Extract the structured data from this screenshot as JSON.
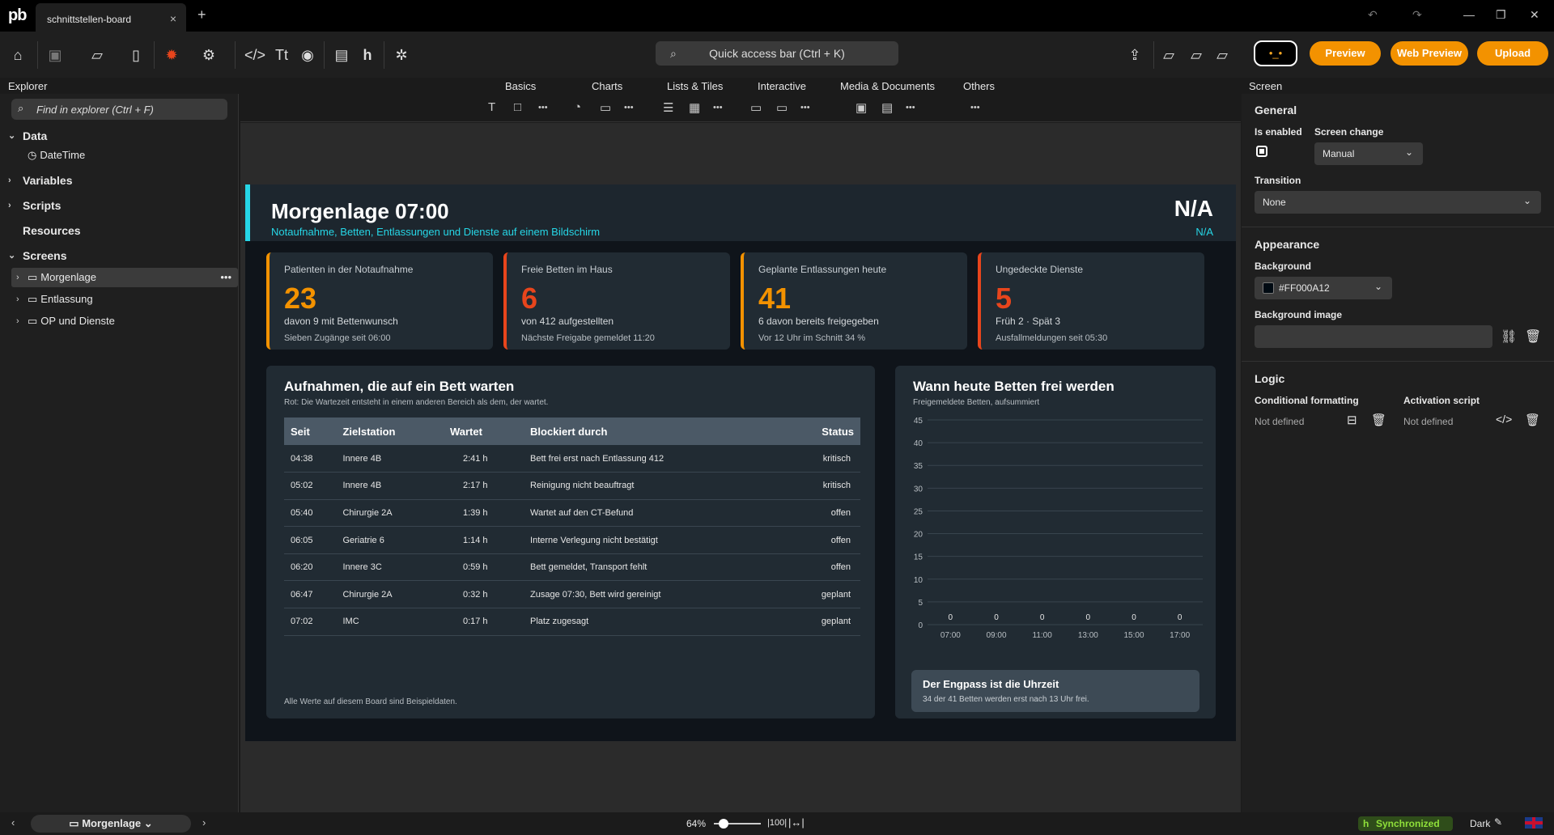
{
  "app": {
    "logo": "pb",
    "tab_title": "schnittstellen-board",
    "tab_close": "×",
    "new_tab": "+"
  },
  "toolbar": {
    "quick_access": "Quick access bar (Ctrl + K)",
    "preview": "Preview",
    "web_preview": "Web Preview",
    "upload": "Upload"
  },
  "sections": {
    "explorer": "Explorer",
    "basics": "Basics",
    "charts": "Charts",
    "lists": "Lists & Tiles",
    "interactive": "Interactive",
    "media": "Media & Documents",
    "others": "Others",
    "screen": "Screen"
  },
  "explorer": {
    "search_placeholder": "Find in explorer (Ctrl + F)",
    "data": "Data",
    "datetime": "DateTime",
    "variables": "Variables",
    "scripts": "Scripts",
    "resources": "Resources",
    "screens": "Screens",
    "screen_items": [
      "Morgenlage",
      "Entlassung",
      "OP und Dienste"
    ],
    "more": "•••"
  },
  "board": {
    "title": "Morgenlage 07:00",
    "subtitle": "Notaufnahme, Betten, Entlassungen und Dienste auf einem Bildschirm",
    "na": "N/A",
    "na2": "N/A",
    "kpis": [
      {
        "label": "Patienten in der Notaufnahme",
        "value": "23",
        "sub": "davon 9 mit Bettenwunsch",
        "foot": "Sieben Zugänge seit 06:00"
      },
      {
        "label": "Freie Betten im Haus",
        "value": "6",
        "sub": "von 412 aufgestellten",
        "foot": "Nächste Freigabe gemeldet 11:20"
      },
      {
        "label": "Geplante Entlassungen heute",
        "value": "41",
        "sub": "6 davon bereits freigegeben",
        "foot": "Vor 12 Uhr im Schnitt 34 %"
      },
      {
        "label": "Ungedeckte Dienste",
        "value": "5",
        "sub": "Früh 2 · Spät 3",
        "foot": "Ausfallmeldungen seit 05:30"
      }
    ],
    "table_panel": {
      "title": "Aufnahmen, die auf ein Bett warten",
      "subtitle": "Rot: Die Wartezeit entsteht in einem anderen Bereich als dem, der wartet.",
      "footer": "Alle Werte auf diesem Board sind Beispieldaten.",
      "headers": [
        "Seit",
        "Zielstation",
        "Wartet",
        "Blockiert durch",
        "Status"
      ],
      "rows": [
        [
          "04:38",
          "Innere 4B",
          "2:41 h",
          "Bett frei erst nach Entlassung 412",
          "kritisch"
        ],
        [
          "05:02",
          "Innere 4B",
          "2:17 h",
          "Reinigung nicht beauftragt",
          "kritisch"
        ],
        [
          "05:40",
          "Chirurgie 2A",
          "1:39 h",
          "Wartet auf den CT-Befund",
          "offen"
        ],
        [
          "06:05",
          "Geriatrie 6",
          "1:14 h",
          "Interne Verlegung nicht bestätigt",
          "offen"
        ],
        [
          "06:20",
          "Innere 3C",
          "0:59 h",
          "Bett gemeldet, Transport fehlt",
          "offen"
        ],
        [
          "06:47",
          "Chirurgie 2A",
          "0:32 h",
          "Zusage 07:30, Bett wird gereinigt",
          "geplant"
        ],
        [
          "07:02",
          "IMC",
          "0:17 h",
          "Platz zugesagt",
          "geplant"
        ]
      ]
    },
    "chart_panel": {
      "title": "Wann heute Betten frei werden",
      "subtitle": "Freigemeldete Betten, aufsummiert",
      "note_title": "Der Engpass ist die Uhrzeit",
      "note_sub": "34 der 41 Betten werden erst nach 13 Uhr frei."
    }
  },
  "chart_data": {
    "type": "bar",
    "categories": [
      "07:00",
      "09:00",
      "11:00",
      "13:00",
      "15:00",
      "17:00"
    ],
    "values": [
      0,
      0,
      0,
      0,
      0,
      0
    ],
    "ylim": [
      0,
      45
    ],
    "yticks": [
      0,
      5,
      10,
      15,
      20,
      25,
      30,
      35,
      40,
      45
    ],
    "title": "Wann heute Betten frei werden",
    "data_labels": true,
    "grid": true
  },
  "props": {
    "general": "General",
    "is_enabled": "Is enabled",
    "screen_change": "Screen change",
    "screen_change_value": "Manual",
    "transition": "Transition",
    "transition_value": "None",
    "appearance": "Appearance",
    "background": "Background",
    "background_value": "#FF000A12",
    "background_image": "Background image",
    "logic": "Logic",
    "cond_format": "Conditional formatting",
    "activation": "Activation script",
    "not_defined1": "Not defined",
    "not_defined2": "Not defined"
  },
  "status": {
    "screen": "Morgenlage",
    "zoom": "64%",
    "synced": "Synchronized",
    "theme": "Dark"
  },
  "colors": {
    "accent": "#f39200",
    "cyan": "#26d6e6",
    "red": "#e8451c"
  }
}
